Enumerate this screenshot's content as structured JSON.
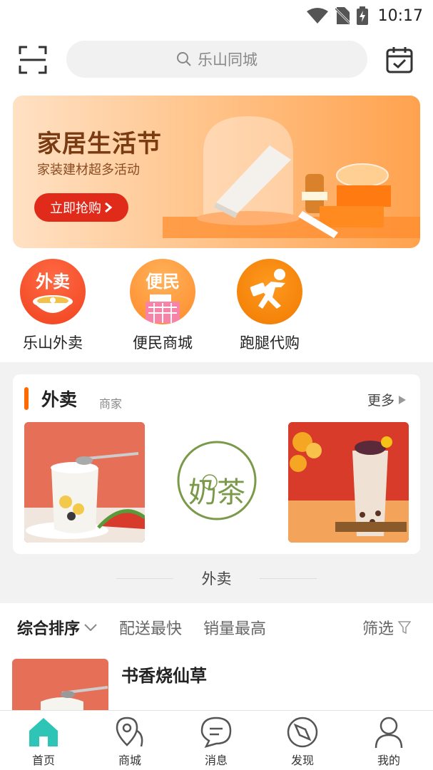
{
  "status_bar": {
    "time": "10:17"
  },
  "header": {
    "search_placeholder": "乐山同城"
  },
  "banner": {
    "title": "家居生活节",
    "subtitle": "家装建材超多活动",
    "cta_label": "立即抢购"
  },
  "categories": [
    {
      "badge": "外卖",
      "label": "乐山外卖"
    },
    {
      "badge": "便民",
      "label": "便民商城"
    },
    {
      "badge": "",
      "label": "跑腿代购"
    }
  ],
  "takeout_card": {
    "title": "外卖",
    "subtitle": "商家",
    "more_label": "更多",
    "logo_text": "奶茶"
  },
  "section_divider": "外卖",
  "sort_bar": {
    "sort_label": "综合排序",
    "fastest_label": "配送最快",
    "sales_label": "销量最高",
    "filter_label": "筛选"
  },
  "shop_list": [
    {
      "name": "书香烧仙草"
    }
  ],
  "tab_bar": [
    {
      "label": "首页"
    },
    {
      "label": "商城"
    },
    {
      "label": "消息"
    },
    {
      "label": "发现"
    },
    {
      "label": "我的"
    }
  ],
  "colors": {
    "accent": "#2ec4b6",
    "orange": "#ff6a00",
    "cta_red": "#e02b1a"
  }
}
